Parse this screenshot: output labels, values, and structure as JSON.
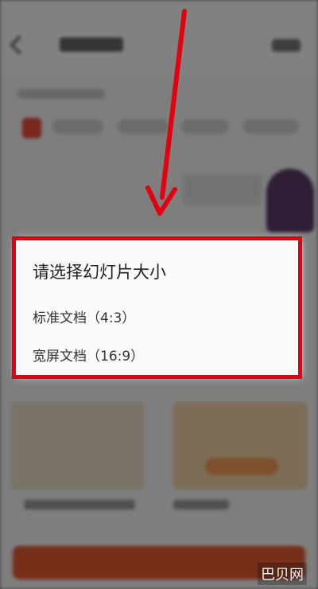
{
  "dialog": {
    "title": "请选择幻灯片大小",
    "options": [
      {
        "label": "标准文档（4:3）"
      },
      {
        "label": "宽屏文档（16:9）"
      }
    ]
  },
  "annotation": {
    "color": "#e3000f"
  },
  "watermark": "巴贝网"
}
